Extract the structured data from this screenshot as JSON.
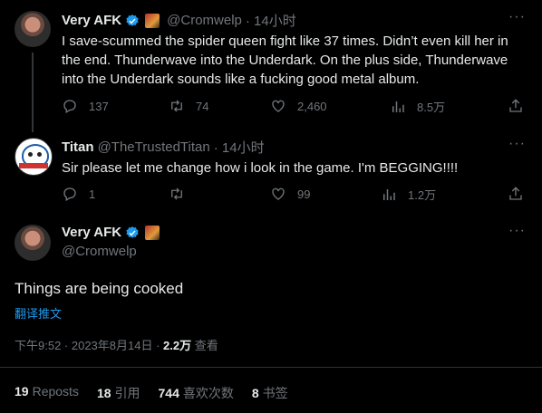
{
  "tweets": [
    {
      "name": "Very AFK",
      "handle": "@Cromwelp",
      "time": "· 14小时",
      "text": "I save-scummed the spider queen fight like 37 times. Didn’t even kill her in the end. Thunderwave into the Underdark. On the plus side, Thunderwave into the Underdark sounds like a fucking good metal album.",
      "replies": "137",
      "retweets": "74",
      "likes": "2,460",
      "views": "8.5万"
    },
    {
      "name": "Titan",
      "handle": "@TheTrustedTitan",
      "time": "· 14小时",
      "text": "Sir please let me change how i look in the game. I'm BEGGING!!!!",
      "replies": "1",
      "retweets": "",
      "likes": "99",
      "views": "1.2万"
    }
  ],
  "main_tweet": {
    "name": "Very AFK",
    "handle": "@Cromwelp",
    "text": "Things are being cooked",
    "translate_label": "翻译推文",
    "timestamp": "下午9:52 · 2023年8月14日 · ",
    "views_count": "2.2万",
    "views_label": " 查看",
    "stats": [
      {
        "count": "19",
        "label": "Reposts"
      },
      {
        "count": "18",
        "label": "引用"
      },
      {
        "count": "744",
        "label": "喜欢次数"
      },
      {
        "count": "8",
        "label": "书签"
      }
    ]
  },
  "more_glyph": "···",
  "colors": {
    "accent": "#1d9bf0",
    "muted": "#71767b",
    "text": "#e7e9ea",
    "background": "#000000"
  },
  "icons": [
    "reply-icon",
    "retweet-icon",
    "like-icon",
    "views-icon",
    "share-icon",
    "verified-icon",
    "more-icon"
  ]
}
